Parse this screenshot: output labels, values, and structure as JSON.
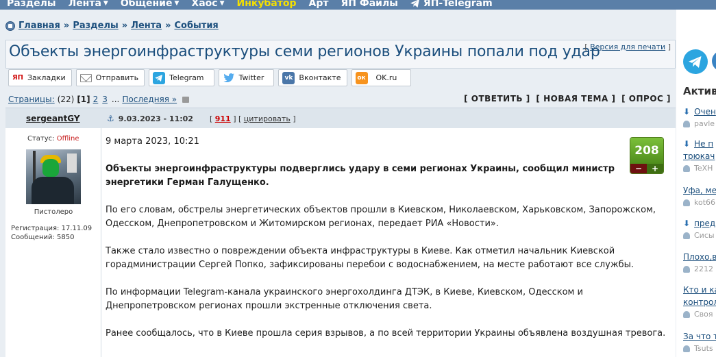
{
  "topnav": {
    "items": [
      {
        "label": "Разделы",
        "caret": false
      },
      {
        "label": "Лента",
        "caret": true
      },
      {
        "label": "Общение",
        "caret": true
      },
      {
        "label": "Хаос",
        "caret": true
      },
      {
        "label": "Инкубатор",
        "caret": false,
        "highlight": true
      },
      {
        "label": "Арт",
        "caret": false
      },
      {
        "label": "ЯП Файлы",
        "caret": false
      },
      {
        "label": "ЯП-Telegram",
        "caret": false,
        "icon": "telegram-icon"
      }
    ]
  },
  "breadcrumb": {
    "items": [
      "Главная",
      "Разделы",
      "Лента",
      "События"
    ],
    "separator": "»"
  },
  "topic": {
    "title": "Объекты энергоинфраструктуры семи регионов Украины попали под удар",
    "print_link": "Версия для печати"
  },
  "share": {
    "buttons": [
      {
        "label": "Закладки",
        "icon": "yap-icon"
      },
      {
        "label": "Отправить",
        "icon": "mail-icon"
      },
      {
        "label": "Telegram",
        "icon": "telegram-icon"
      },
      {
        "label": "Twitter",
        "icon": "twitter-icon"
      },
      {
        "label": "Вконтакте",
        "icon": "vk-icon"
      },
      {
        "label": "OK.ru",
        "icon": "ok-icon"
      }
    ]
  },
  "pagination": {
    "label": "Страницы:",
    "total": "(22)",
    "current": "[1]",
    "pages": [
      "2",
      "3"
    ],
    "dots": "...",
    "last": "Последняя »"
  },
  "actions": {
    "reply": "[ ОТВЕТИТЬ ]",
    "new_topic": "[ НОВАЯ ТЕМА ]",
    "poll": "[ ОПРОС ]"
  },
  "post": {
    "author": "sergeantGY",
    "status_label": "Статус:",
    "status_value": "Offline",
    "rank": "Пистолеро",
    "registered": "Регистрация: 17.11.09",
    "messages": "Сообщений: 5850",
    "date": "9.03.2023 - 11:02",
    "post_number": "911",
    "cite": "цитировать",
    "rating": "208",
    "rating_minus": "−",
    "rating_plus": "+",
    "paragraphs": [
      "9 марта 2023, 10:21",
      "Объекты энергоинфраструктуры подверглись удару в семи регионах Украины, сообщил министр энергетики Герман Галущенко.",
      "По его словам, обстрелы энергетических объектов прошли в Киевском, Николаевском, Харьковском, Запорожском, Одесском, Днепропетровском и Житомирском регионах, передает РИА «Новости».",
      "Также стало известно о повреждении объекта инфраструктуры в Киеве. Как отметил начальник Киевской горадминистрации Сергей Попко, зафиксированы перебои с водоснабжением, на месте работают все службы.",
      "По информации Telegram-канала украинского энергохолдинга ДТЭК, в Киеве, Киевском, Одесском и Днепропетровском регионах прошли экстренные отключения света.",
      "Ранее сообщалось, что в Киеве прошла серия взрывов, а по всей территории Украины объявлена воздушная тревога."
    ]
  },
  "sidebar": {
    "heading": "Актив",
    "items": [
      {
        "title": "Очен",
        "user": "pavle",
        "arrow": true
      },
      {
        "title": "Не п",
        "title2": "трюкач",
        "user": "TeXH",
        "arrow": true
      },
      {
        "title": "Уфа, ме",
        "user": "kot66",
        "arrow": false
      },
      {
        "title": "пред",
        "user": "Сисы",
        "arrow": true
      },
      {
        "title": "Плохо,в",
        "user": "2212",
        "arrow": false
      },
      {
        "title": "Кто и ка",
        "title2": "контрол",
        "user": "Своя",
        "arrow": false
      },
      {
        "title": "За что т",
        "user": "Tsuts",
        "arrow": false
      }
    ]
  },
  "colors": {
    "nav_bg": "#5a7fa8",
    "accent_link": "#1c4f7d",
    "highlight": "#f5e000",
    "offline": "#c81e1e",
    "rating_green": "#5fa02a",
    "post_number": "#cc0000"
  }
}
